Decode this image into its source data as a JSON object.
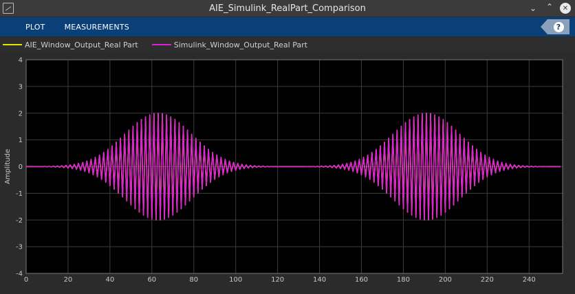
{
  "window": {
    "title": "AIE_Simulink_RealPart_Comparison",
    "icon": "scope-app-icon",
    "controls": [
      "chevron-down-icon",
      "chevron-up-icon",
      "close-icon"
    ]
  },
  "toolstrip": {
    "tabs": [
      {
        "label": "PLOT"
      },
      {
        "label": "MEASUREMENTS"
      }
    ],
    "help_label": "?",
    "color": "#0b3f78"
  },
  "legend": {
    "items": [
      {
        "label": "AIE_Window_Output_Real Part",
        "color": "#e5e500"
      },
      {
        "label": "Simulink_Window_Output_Real Part",
        "color": "#e020d8"
      }
    ]
  },
  "chart_data": {
    "type": "line",
    "title": "",
    "xlabel": "",
    "ylabel": "Amplitude",
    "xlim": [
      0,
      256
    ],
    "ylim": [
      -4,
      4
    ],
    "xticks": [
      0,
      20,
      40,
      60,
      80,
      100,
      120,
      140,
      160,
      180,
      200,
      220,
      240
    ],
    "yticks": [
      -4,
      -3,
      -2,
      -1,
      0,
      1,
      2,
      3,
      4
    ],
    "grid": true,
    "background": "#000000",
    "series": [
      {
        "name": "AIE_Window_Output_Real Part",
        "color": "#e5e500",
        "description": "overlapped by Simulink series",
        "bursts": [
          {
            "center": 63,
            "sigma": 16,
            "peak": 2.0
          },
          {
            "center": 191,
            "sigma": 16,
            "peak": 2.0
          }
        ],
        "samples": 256
      },
      {
        "name": "Simulink_Window_Output_Real Part",
        "color": "#e020d8",
        "bursts": [
          {
            "center": 63,
            "sigma": 16,
            "peak": 2.0
          },
          {
            "center": 191,
            "sigma": 16,
            "peak": 2.0
          }
        ],
        "samples": 256
      }
    ]
  }
}
